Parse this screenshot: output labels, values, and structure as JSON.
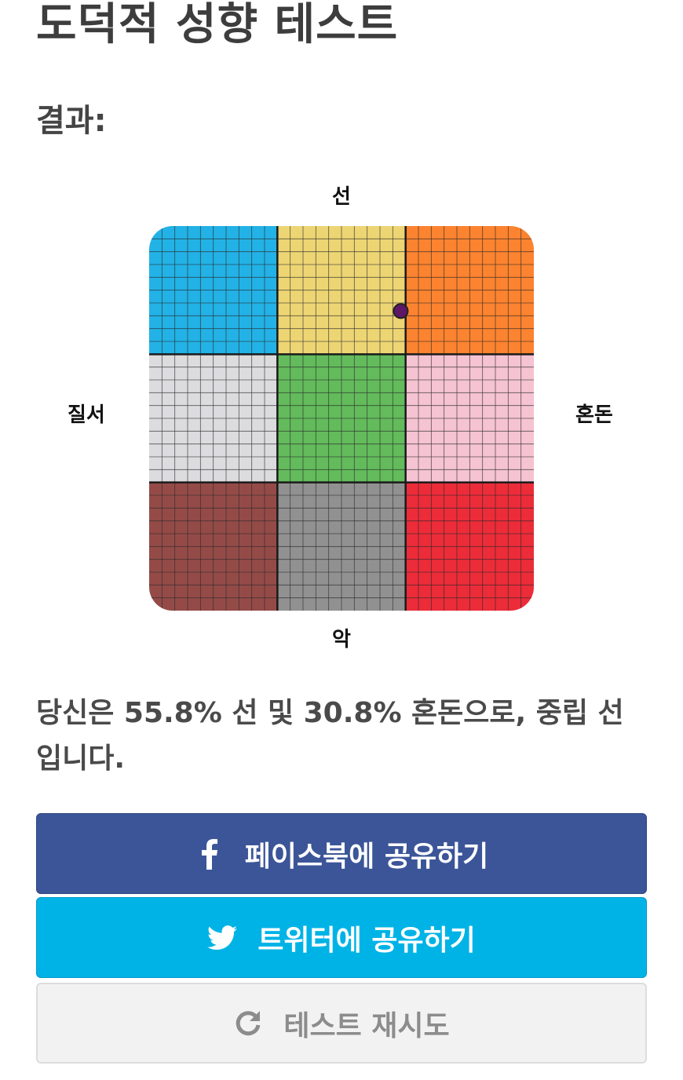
{
  "page": {
    "title": "도덕적 성향 테스트",
    "result_heading": "결과:"
  },
  "chart_data": {
    "type": "scatter",
    "title": "",
    "axes": {
      "top": "선",
      "bottom": "악",
      "left": "질서",
      "right": "혼돈"
    },
    "x_range": [
      -100,
      100
    ],
    "y_range": [
      -100,
      100
    ],
    "grid_cells_per_side": 30,
    "cells": [
      {
        "row": 0,
        "col": 0,
        "color": "#22b2e6"
      },
      {
        "row": 0,
        "col": 1,
        "color": "#edd574"
      },
      {
        "row": 0,
        "col": 2,
        "color": "#fc832f"
      },
      {
        "row": 1,
        "col": 0,
        "color": "#dcdcdf"
      },
      {
        "row": 1,
        "col": 1,
        "color": "#63bb5c"
      },
      {
        "row": 1,
        "col": 2,
        "color": "#f5c3d2"
      },
      {
        "row": 2,
        "col": 0,
        "color": "#944b48"
      },
      {
        "row": 2,
        "col": 1,
        "color": "#919191"
      },
      {
        "row": 2,
        "col": 2,
        "color": "#ec2c39"
      }
    ],
    "point": {
      "x": 30.8,
      "y": 55.8,
      "color": "#5e1767"
    }
  },
  "summary": {
    "text": "당신은 55.8% 선 및 30.8% 혼돈으로, 중립 선입니다."
  },
  "buttons": {
    "facebook": {
      "label": "페이스북에 공유하기",
      "icon": "facebook-icon",
      "color": "#3b5598"
    },
    "twitter": {
      "label": "트위터에 공유하기",
      "icon": "twitter-icon",
      "color": "#00b3e6"
    },
    "retry": {
      "label": "테스트 재시도",
      "icon": "refresh-icon"
    }
  }
}
